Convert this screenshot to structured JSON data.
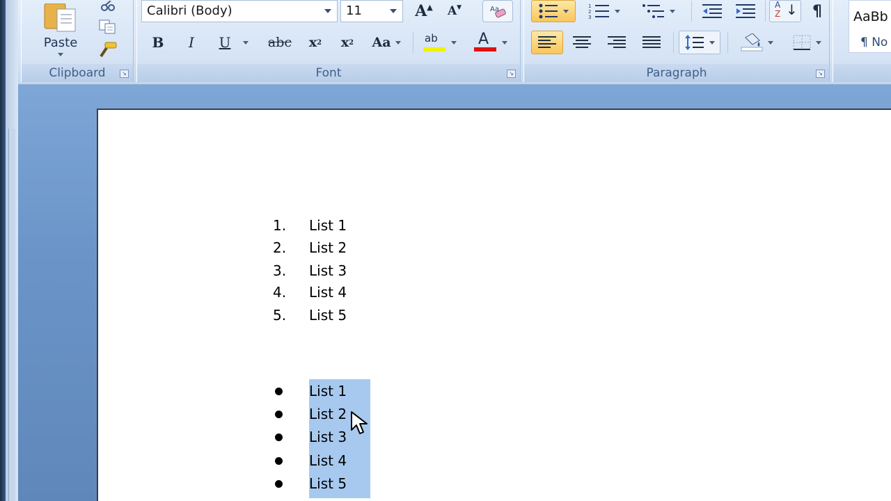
{
  "clipboard": {
    "paste_label": "Paste",
    "group_label": "Clipboard"
  },
  "font": {
    "font_name": "Calibri (Body)",
    "font_size": "11",
    "group_label": "Font",
    "bold": "B",
    "italic": "I",
    "underline": "U",
    "strike": "abc",
    "subscript": "x",
    "subscript_mark": "2",
    "superscript": "x",
    "superscript_mark": "2",
    "change_case": "Aa",
    "grow": "A",
    "shrink": "A",
    "highlight_text": "ab",
    "font_color_text": "A",
    "highlight_color": "#f2f200",
    "font_color": "#e01010"
  },
  "paragraph": {
    "group_label": "Paragraph",
    "sort_a": "A",
    "sort_z": "Z",
    "pilcrow": "¶"
  },
  "styles": {
    "preview_text": "AaBb",
    "style_name": "¶ No"
  },
  "numbered_list": [
    {
      "marker": "1.",
      "text": "List 1"
    },
    {
      "marker": "2.",
      "text": "List 2"
    },
    {
      "marker": "3.",
      "text": "List 3"
    },
    {
      "marker": "4.",
      "text": "List 4"
    },
    {
      "marker": "5.",
      "text": "List 5"
    }
  ],
  "bulleted_list": [
    {
      "text": "List 1"
    },
    {
      "text": "List 2"
    },
    {
      "text": "List 3"
    },
    {
      "text": "List 4"
    },
    {
      "text": "List 5"
    }
  ],
  "colors": {
    "selection": "#a7c9ef",
    "active_button": "#f9c65a",
    "ribbon_label": "#3e5f8a"
  }
}
